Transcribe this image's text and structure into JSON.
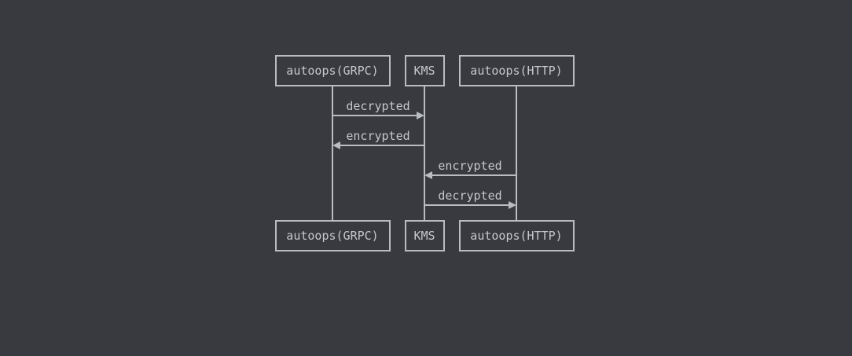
{
  "participants": [
    {
      "id": "grpc",
      "label": "autoops(GRPC)"
    },
    {
      "id": "kms",
      "label": "KMS"
    },
    {
      "id": "http",
      "label": "autoops(HTTP)"
    }
  ],
  "messages": [
    {
      "from": "grpc",
      "to": "kms",
      "label": "decrypted"
    },
    {
      "from": "kms",
      "to": "grpc",
      "label": "encrypted"
    },
    {
      "from": "http",
      "to": "kms",
      "label": "encrypted"
    },
    {
      "from": "kms",
      "to": "http",
      "label": "decrypted"
    }
  ],
  "colors": {
    "background": "#383a3f",
    "stroke": "#b9bcc2",
    "text": "#c4c7cd"
  }
}
